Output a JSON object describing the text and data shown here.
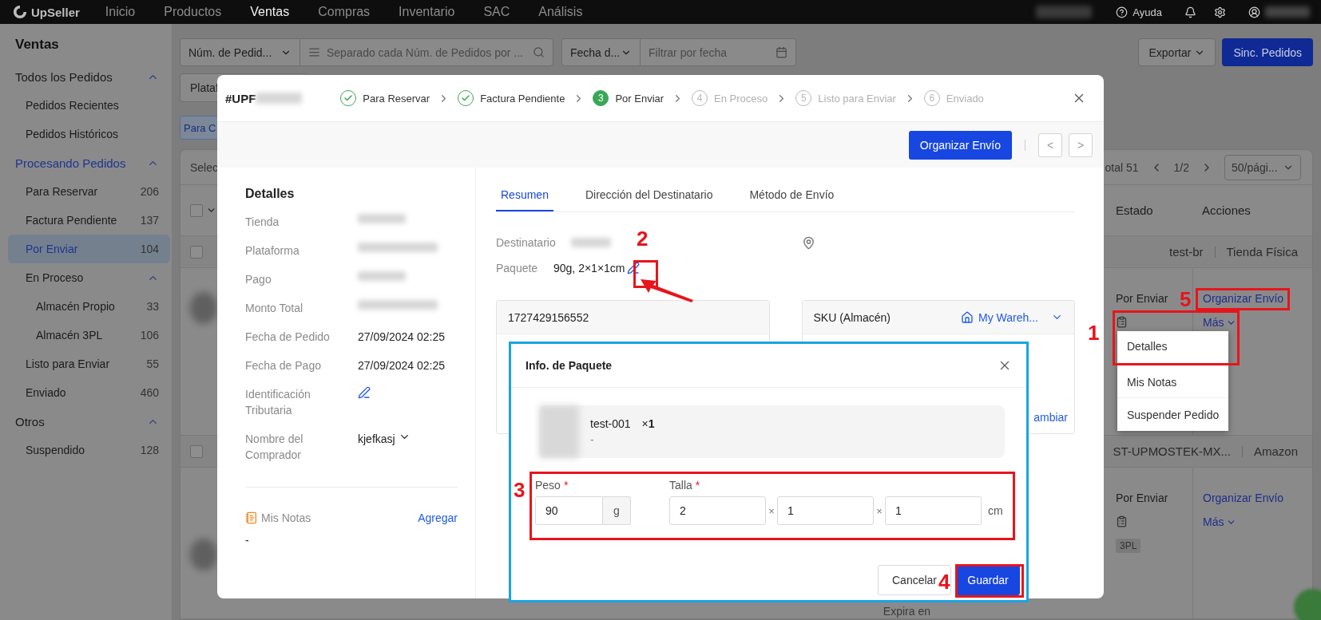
{
  "nav": {
    "logo": "UpSeller",
    "items": [
      {
        "label": "Inicio",
        "selected": false
      },
      {
        "label": "Productos",
        "selected": false
      },
      {
        "label": "Ventas",
        "selected": true
      },
      {
        "label": "Compras",
        "selected": false
      },
      {
        "label": "Inventario",
        "selected": false
      },
      {
        "label": "SAC",
        "selected": false
      },
      {
        "label": "Análisis",
        "selected": false
      }
    ],
    "help": "Ayuda"
  },
  "sidebar": {
    "title": "Ventas",
    "items": [
      {
        "label": "Todos los Pedidos",
        "active": false,
        "selected": false,
        "expanded": true,
        "children": [
          {
            "label": "Pedidos Recientes",
            "selected": false
          },
          {
            "label": "Pedidos Históricos",
            "selected": false
          }
        ]
      },
      {
        "label": "Procesando Pedidos",
        "active": true,
        "selected": false,
        "expanded": true,
        "children": [
          {
            "label": "Para Reservar",
            "count": "206",
            "selected": false
          },
          {
            "label": "Factura Pendiente",
            "count": "137",
            "selected": false
          },
          {
            "label": "Por Enviar",
            "count": "104",
            "selected": true
          },
          {
            "label": "En Proceso",
            "selected": false,
            "expanded": true,
            "children": [
              {
                "label": "Almacén Propio",
                "count": "33",
                "selected": false
              },
              {
                "label": "Almacén 3PL",
                "count": "106",
                "selected": false
              }
            ]
          },
          {
            "label": "Listo para Enviar",
            "count": "55",
            "selected": false
          },
          {
            "label": "Enviado",
            "count": "460",
            "selected": false
          }
        ]
      },
      {
        "label": "Otros",
        "active": false,
        "selected": false,
        "expanded": true,
        "children": [
          {
            "label": "Suspendido",
            "count": "128",
            "selected": false
          }
        ]
      }
    ]
  },
  "filters": {
    "search_type": "Núm. de Pedid...",
    "search_placeholder": "Separado cada Núm. de Pedidos por ...",
    "date_type": "Fecha d...",
    "date_placeholder": "Filtrar por fecha",
    "export": "Exportar",
    "sync": "Sinc. Pedidos",
    "platform": "Plataf",
    "quick_button": "Para C"
  },
  "table": {
    "select_label": "Selec",
    "all_checked": false,
    "total": "otal 51",
    "page": "1/2",
    "page_size": "50/pági...",
    "columns": [
      "Estado",
      "Acciones"
    ],
    "rows": [
      {
        "checked": false,
        "store": "test-br",
        "platform": "Tienda Física",
        "status": "Por Enviar",
        "action": "Organizar Envío",
        "more": "Más"
      },
      {
        "checked": false,
        "store": "ST-UPMOSTEK-MX...",
        "platform": "Amazon",
        "status": "Por Enviar",
        "tag": "3PL",
        "action": "Organizar Envío",
        "more": "Más",
        "expiry": "Expira en"
      }
    ]
  },
  "order_modal": {
    "order_no": "#UPF",
    "steps": [
      {
        "label": "Para Reservar",
        "completed": true,
        "selected": false
      },
      {
        "label": "Factura Pendiente",
        "completed": true,
        "selected": false
      },
      {
        "number": "3",
        "label": "Por Enviar",
        "completed": false,
        "selected": true
      },
      {
        "number": "4",
        "label": "En Proceso",
        "completed": false,
        "selected": false
      },
      {
        "number": "5",
        "label": "Listo para Enviar",
        "completed": false,
        "selected": false
      },
      {
        "number": "6",
        "label": "Enviado",
        "completed": false,
        "selected": false
      }
    ],
    "primary_action": "Organizar Envío",
    "prev": "<",
    "next": ">",
    "details": {
      "title": "Detalles",
      "fields": [
        {
          "label": "Tienda",
          "kind": "redacted"
        },
        {
          "label": "Plataforma",
          "kind": "redacted"
        },
        {
          "label": "Pago",
          "kind": "redacted"
        },
        {
          "label": "Monto Total",
          "kind": "redacted"
        },
        {
          "label": "Fecha de Pedido",
          "kind": "text",
          "value": "27/09/2024 02:25"
        },
        {
          "label": "Fecha de Pago",
          "kind": "text",
          "value": "27/09/2024 02:25"
        },
        {
          "label": "Identificación Tributaria",
          "kind": "edit"
        },
        {
          "label": "Nombre del Comprador",
          "kind": "dropdown",
          "value": "kjefkasj"
        }
      ],
      "notes_label": "Mis Notas",
      "notes_add": "Agregar",
      "notes_value": "-"
    },
    "tabs": [
      {
        "label": "Resumen",
        "selected": true
      },
      {
        "label": "Dirección del Destinatario",
        "selected": false
      },
      {
        "label": "Método de Envío",
        "selected": false
      }
    ],
    "summary": {
      "recipient_label": "Destinatario",
      "package_label": "Paquete",
      "package_value": "90g, 2×1×1cm"
    },
    "order_card": {
      "title": "1727429156552"
    },
    "sku_card": {
      "title": "SKU (Almacén)",
      "warehouse": "My Wareh...",
      "change_link": "ambiar"
    }
  },
  "package_dialog": {
    "title": "Info. de Paquete",
    "item": {
      "sku": "test-001",
      "quantity": "×**1**",
      "variant": "-"
    },
    "weight": {
      "label": "Peso",
      "required_mark": "*",
      "value": "90",
      "unit": "g"
    },
    "size": {
      "label": "Talla",
      "required_mark": "*",
      "values": [
        "2",
        "1",
        "1"
      ],
      "separators": [
        "×",
        "×"
      ],
      "unit": "cm"
    },
    "cancel": "Cancelar",
    "save": "Guardar"
  },
  "more_menu": {
    "items": [
      {
        "label": "Detalles"
      },
      {
        "label": "Mis Notas"
      },
      {
        "label": "Suspender Pedido"
      }
    ]
  },
  "annotations": [
    {
      "label": "1"
    },
    {
      "label": "2"
    },
    {
      "label": "3"
    },
    {
      "label": "4"
    },
    {
      "label": "5"
    }
  ]
}
